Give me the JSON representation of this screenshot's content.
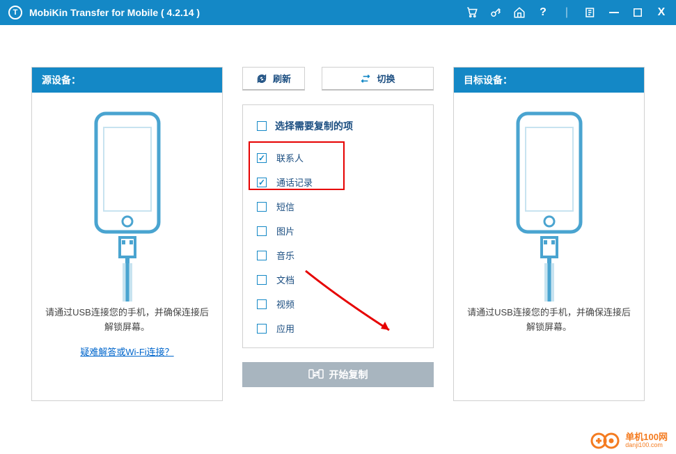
{
  "titleBar": {
    "appName": "MobiKin Transfer for Mobile  ( 4.2.14 )"
  },
  "sourcePanel": {
    "header": "源设备：",
    "instruction": "请通过USB连接您的手机，并确保连接后解锁屏幕。",
    "helpLink": "疑难解答或Wi-Fi连接？"
  },
  "targetPanel": {
    "header": "目标设备：",
    "instruction": "请通过USB连接您的手机，并确保连接后解锁屏幕。"
  },
  "center": {
    "refreshLabel": "刷新",
    "switchLabel": "切换",
    "selectAllLabel": "选择需要复制的项",
    "items": [
      {
        "label": "联系人",
        "checked": true
      },
      {
        "label": "通话记录",
        "checked": true
      },
      {
        "label": "短信",
        "checked": false
      },
      {
        "label": "图片",
        "checked": false
      },
      {
        "label": "音乐",
        "checked": false
      },
      {
        "label": "文档",
        "checked": false
      },
      {
        "label": "视频",
        "checked": false
      },
      {
        "label": "应用",
        "checked": false
      }
    ],
    "startLabel": "开始复制"
  },
  "watermark": {
    "line1": "单机100网",
    "line2": "danji100.com"
  }
}
